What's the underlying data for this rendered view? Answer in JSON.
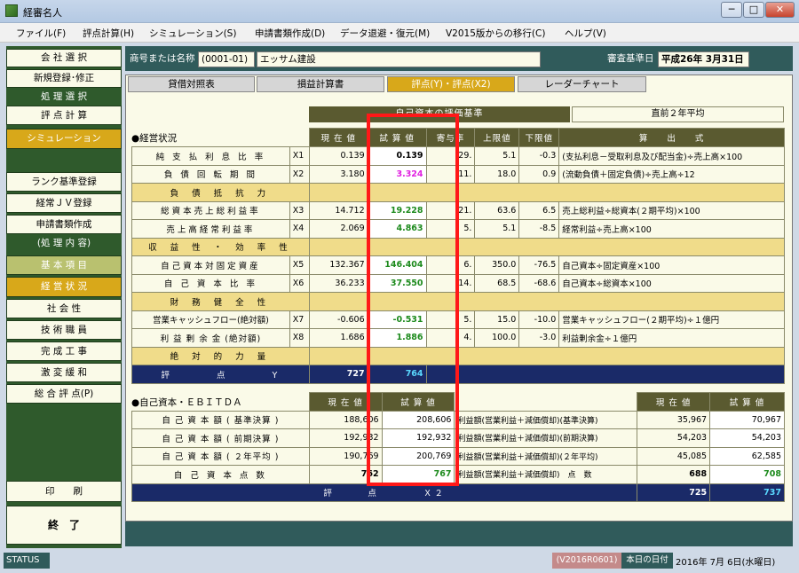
{
  "window": {
    "title": "経審名人"
  },
  "menu": [
    "ファイル(F)",
    "評点計算(H)",
    "シミュレーション(S)",
    "申請書類作成(D)",
    "データ退避・復元(M)",
    "V2015版からの移行(C)",
    "ヘルプ(V)"
  ],
  "sidebar": {
    "company_select": "会 社 選 択",
    "new_register": "新規登録･修正",
    "process_select": "処 理 選 択",
    "score_calc": "評 点 計 算",
    "simulation": "シミュレーション",
    "rank_register": "ランク基準登録",
    "jv_register": "経常ＪＶ登録",
    "app_docs": "申請書類作成",
    "process_contents": "(処 理 内 容)",
    "basic_items": "基 本 項 目",
    "business_status": "経 営 状 況",
    "social": "社 会 性",
    "tech_staff": "技 術 職 員",
    "completed_work": "完 成 工 事",
    "shock_relief": "激 変 緩 和",
    "overall": "総 合 評 点(P)",
    "print": "印　　刷",
    "exit": "終　了"
  },
  "header": {
    "company_label": "商号または名称",
    "company_code": "(0001-01)",
    "company_name": "エッサム建設",
    "date_label": "審査基準日",
    "date_value": "平成26年 3月31日"
  },
  "tabs": [
    "貸借対照表",
    "損益計算書",
    "評点(Y)・評点(X2)",
    "レーダーチャート"
  ],
  "sec1": {
    "title": "●経営状況",
    "band": "自己資本の評価基準",
    "recent": "直前２年平均",
    "cols": [
      "現 在 値",
      "試 算 値",
      "寄与率",
      "上限値",
      "下限値",
      "算　　出　　式"
    ],
    "rows": [
      {
        "name": "純 支 払 利 息 比 率",
        "code": "X1",
        "current": "0.139",
        "trial": "0.139",
        "contrib": "29.",
        "upper": "5.1",
        "lower": "-0.3",
        "formula": "(支払利息－受取利息及び配当金)÷売上高×100"
      },
      {
        "name": "負 債 回 転 期 間",
        "code": "X2",
        "current": "3.180",
        "trial": "3.324",
        "contrib": "11.",
        "upper": "18.0",
        "lower": "0.9",
        "formula": "(流動負債＋固定負債)÷売上高÷12"
      },
      {
        "cat": "負 債 抵 抗 力"
      },
      {
        "name": "総資本売上総利益率",
        "code": "X3",
        "current": "14.712",
        "trial": "19.228",
        "contrib": "21.",
        "upper": "63.6",
        "lower": "6.5",
        "formula": "売上総利益÷総資本(２期平均)×100"
      },
      {
        "name": "売上高経常利益率",
        "code": "X4",
        "current": "2.069",
        "trial": "4.863",
        "contrib": "5.",
        "upper": "5.1",
        "lower": "-8.5",
        "formula": "経常利益÷売上高×100"
      },
      {
        "cat": "収 益 性 ・ 効 率 性"
      },
      {
        "name": "自己資本対固定資産",
        "code": "X5",
        "current": "132.367",
        "trial": "146.404",
        "contrib": "6.",
        "upper": "350.0",
        "lower": "-76.5",
        "formula": "自己資本÷固定資産×100"
      },
      {
        "name": "自 己 資 本 比 率",
        "code": "X6",
        "current": "36.233",
        "trial": "37.550",
        "contrib": "14.",
        "upper": "68.5",
        "lower": "-68.6",
        "formula": "自己資本÷総資本×100"
      },
      {
        "cat": "財 務 健 全 性"
      },
      {
        "name": "営業キャッシュフロー(絶対額)",
        "code": "X7",
        "current": "-0.606",
        "trial": "-0.531",
        "contrib": "5.",
        "upper": "15.0",
        "lower": "-10.0",
        "formula": "営業キャッシュフロー(２期平均)÷１億円"
      },
      {
        "name": "利 益 剰 余 金 (絶対額)",
        "code": "X8",
        "current": "1.686",
        "trial": "1.886",
        "contrib": "4.",
        "upper": "100.0",
        "lower": "-3.0",
        "formula": "利益剰余金÷１億円"
      },
      {
        "cat": "絶 対 的 力 量"
      }
    ],
    "score_label": "評　　　　点　　　　Y",
    "score_current": "727",
    "score_trial": "764"
  },
  "sec2": {
    "title": "●自己資本・ＥＢＩＴＤＡ",
    "cols": [
      "現 在 値",
      "試 算 値"
    ],
    "rows": [
      {
        "name": "自 己 資 本 額 ( 基準決算 )",
        "current": "188,606",
        "trial": "208,606",
        "r_name": "利益額(営業利益＋減価償却)(基準決算)",
        "r_current": "35,967",
        "r_trial": "70,967"
      },
      {
        "name": "自 己 資 本 額 ( 前期決算 )",
        "current": "192,932",
        "trial": "192,932",
        "r_name": "利益額(営業利益＋減価償却)(前期決算)",
        "r_current": "54,203",
        "r_trial": "54,203"
      },
      {
        "name": "自 己 資 本 額 ( ２年平均 )",
        "current": "190,769",
        "trial": "200,769",
        "r_name": "利益額(営業利益＋減価償却)(２年平均)",
        "r_current": "45,085",
        "r_trial": "62,585"
      },
      {
        "name": "自 己 資 本 点 数",
        "current": "762",
        "trial": "767",
        "r_name": "利益額(営業利益＋減価償却)　点　数",
        "r_current": "688",
        "r_trial": "708"
      }
    ],
    "score_label": "評　　　点　　　　Ｘ２",
    "score_current": "725",
    "score_trial": "737"
  },
  "status": {
    "label": "STATUS",
    "version": "(V2016R0601)",
    "today_label": "本日の日付",
    "today": "2016年 7月 6日(水曜日)"
  },
  "colors": {
    "sidebar": "#2f5a2c",
    "gold": "#d8a81a",
    "navy": "#1a2a68",
    "highlight": "#ff1818"
  }
}
